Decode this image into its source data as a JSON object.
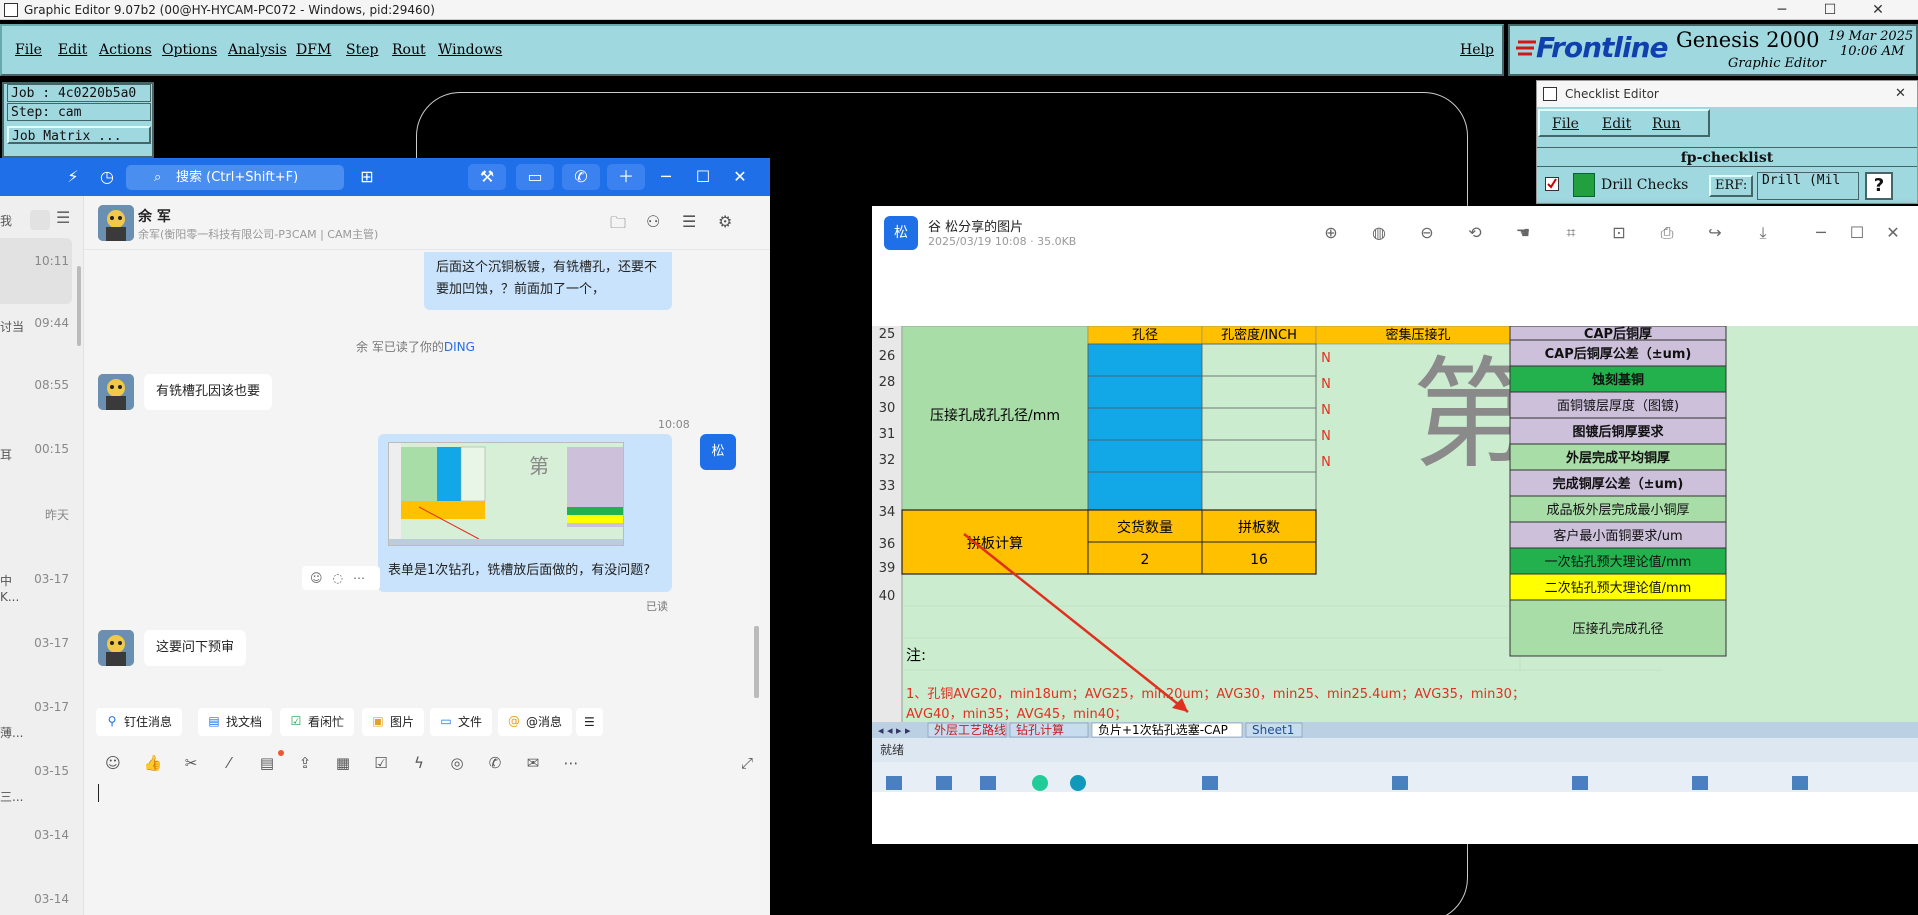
{
  "genesis": {
    "window_title": "Graphic Editor 9.07b2 (00@HY-HYCAM-PC072 - Windows, pid:29460)",
    "menu": [
      "File",
      "Edit",
      "Actions",
      "Options",
      "Analysis",
      "DFM",
      "Step",
      "Rout",
      "Windows"
    ],
    "help": "Help",
    "brand": "Frontline",
    "product": "Genesis 2000",
    "subtitle": "Graphic Editor",
    "date": "19 Mar 2025",
    "time": "10:06 AM",
    "job_line": "Job : 4c0220b5a0",
    "step_line": "Step: cam",
    "job_matrix": "Job Matrix ..."
  },
  "checklist": {
    "title": "Checklist Editor",
    "menu": [
      "File",
      "Edit",
      "Run"
    ],
    "name": "fp-checklist",
    "item_label": "Drill Checks",
    "erf_label": "ERF:",
    "erf_value": "Drill (Mil",
    "help_btn": "?"
  },
  "im": {
    "search_placeholder": "搜索 (Ctrl+Shift+F)",
    "conv_times": [
      "10:11",
      "09:44",
      "08:55",
      "00:15",
      "昨天",
      "03-17",
      "03-17",
      "03-17",
      "03-15",
      "03-14",
      "03-14"
    ],
    "conv_stubs": [
      "我",
      "讨当",
      "耳",
      "中",
      "K...",
      "薄...",
      "三..."
    ],
    "contact_name": "余 军",
    "contact_sub": "余军(衡阳零一科技有限公司-P3CAM | CAM主管)",
    "msg_out_1": "后面这个沉铜板镀，有铣槽孔，还要不要加凹蚀，？前面加了一个，",
    "read_notice_prefix": "余 军已读了你的",
    "read_notice_link": "DING",
    "msg_in_1": "有铣槽孔因该也要",
    "time_1008": "10:08",
    "self_badge": "松",
    "msg_out_2": "表单是1次钻孔，铣槽放后面做的，有没问题?",
    "read_label": "已读",
    "msg_in_2": "这要问下预审",
    "tools": [
      "钉住消息",
      "找文档",
      "看闲忙",
      "图片",
      "文件",
      "@消息"
    ]
  },
  "viewer": {
    "badge": "松",
    "title": "谷 松分享的图片",
    "meta": "2025/03/19 10:08 · 35.0KB"
  },
  "sheet": {
    "row_numbers": [
      "25",
      "26",
      "28",
      "30",
      "31",
      "32",
      "33",
      "34",
      "36",
      "39",
      "40"
    ],
    "header_partial": [
      "孔径",
      "孔密度/INCH",
      "密集压接孔"
    ],
    "press_label": "压接孔成孔孔径/mm",
    "n_values": [
      "N",
      "N",
      "N",
      "N",
      "N"
    ],
    "panel_calc": "拼板计算",
    "delivery_qty_label": "交货数量",
    "panel_count_label": "拼板数",
    "delivery_qty": "2",
    "panel_count": "16",
    "watermark": "第",
    "note_label": "注:",
    "note_line1": "1、孔铜AVG20，min18um；AVG25，min20um；AVG30，min25、min25.4um；AVG35，min30；",
    "note_line2": "AVG40，min35；AVG45，min40；",
    "right_items": [
      "CAP后铜厚",
      "CAP后铜厚公差（±um)",
      "蚀刻基铜",
      "面铜镀层厚度（图镀)",
      "图镀后铜厚要求",
      "外层完成平均铜厚",
      "完成铜厚公差（±um)",
      "成品板外层完成最小铜厚",
      "客户最小面铜要求/um",
      "一次钻孔预大理论值/mm",
      "二次钻孔预大理论值/mm",
      "压接孔完成孔径"
    ],
    "tabs": [
      "外层工艺路线",
      "钻孔计算",
      "负片+1次钻孔选塞-CAP",
      "Sheet1"
    ],
    "status": "就绪",
    "colors": {
      "green": "#a8dda8",
      "blue": "#12a8e8",
      "orange": "#ffc000",
      "purple": "#ccc0da",
      "bright_green": "#22b14c",
      "yellow": "#ffff00",
      "red": "#e03020"
    }
  }
}
